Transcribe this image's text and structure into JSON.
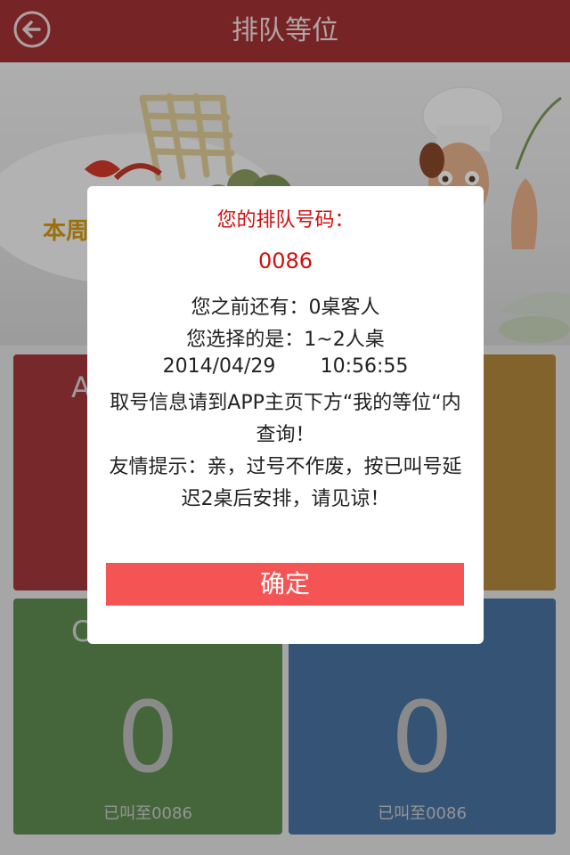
{
  "header": {
    "title": "排队等位",
    "back_icon": "back-arrow-icon"
  },
  "banner": {
    "text": "本周"
  },
  "tiles": [
    {
      "code": "A",
      "count": "",
      "called": ""
    },
    {
      "code": "",
      "count": "",
      "called": ""
    },
    {
      "code": "C",
      "count": "0",
      "called": "已叫至0086"
    },
    {
      "code": "",
      "count": "0",
      "called": "已叫至0086"
    }
  ],
  "dialog": {
    "title": "您的排队号码：",
    "number": "0086",
    "ahead": "您之前还有：0桌客人",
    "selected": "您选择的是：1~2人桌",
    "date": "2014/04/29",
    "time": "10:56:55",
    "info": "取号信息请到APP主页下方“我的等位“内查询！",
    "tip": "友情提示：亲，过号不作废，按已叫号延迟2桌后安排，请见谅！",
    "confirm_label": "确定"
  },
  "colors": {
    "header": "#a53237",
    "tile_a": "#a6383b",
    "tile_b": "#b68a3d",
    "tile_c": "#5f8e51",
    "tile_d": "#4874a2",
    "accent_red": "#d01010",
    "confirm_button": "#f55454"
  }
}
